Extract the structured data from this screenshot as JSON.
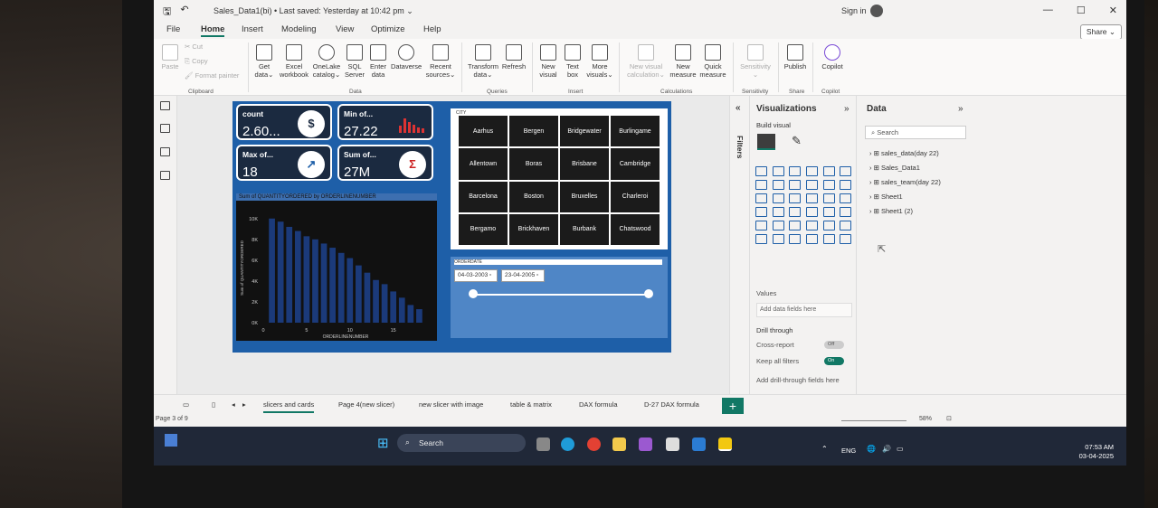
{
  "window": {
    "title": "Sales_Data1(bi) • Last saved: Yesterday at 10:42 pm ⌄",
    "signin": "Sign in"
  },
  "menu": {
    "tabs": [
      "File",
      "Home",
      "Insert",
      "Modeling",
      "View",
      "Optimize",
      "Help"
    ],
    "active": "Home",
    "share": "Share ⌄"
  },
  "ribbon": {
    "clipboard": {
      "paste": "Paste",
      "cut": "Cut",
      "copy": "Copy",
      "format_painter": "Format painter",
      "group": "Clipboard"
    },
    "data": {
      "get_data": "Get data⌄",
      "excel": "Excel workbook",
      "onelake": "OneLake catalog⌄",
      "sql": "SQL Server",
      "enter": "Enter data",
      "dataverse": "Dataverse",
      "recent": "Recent sources⌄",
      "group": "Data"
    },
    "queries": {
      "transform": "Transform data⌄",
      "refresh": "Refresh",
      "group": "Queries"
    },
    "insert": {
      "new_visual": "New visual",
      "text_box": "Text box",
      "more_visuals": "More visuals⌄",
      "group": "Insert"
    },
    "calculations": {
      "new_visual_calc": "New visual calculation⌄",
      "new_measure": "New measure",
      "quick_measure": "Quick measure",
      "group": "Calculations"
    },
    "sensitivity": {
      "label": "Sensitivity ⌄",
      "group": "Sensitivity"
    },
    "share": {
      "publish": "Publish",
      "group": "Share"
    },
    "copilot": {
      "label": "Copilot",
      "group": "Copilot"
    }
  },
  "report": {
    "cards": [
      {
        "title": "count",
        "value": "2.60..."
      },
      {
        "title": "Min of...",
        "value": "27.22"
      },
      {
        "title": "Max of...",
        "value": "18"
      },
      {
        "title": "Sum of...",
        "value": "27M"
      }
    ],
    "chart_title": "Sum of QUANTITYORDERED by ORDERLINENUMBER",
    "slicer_title": "CITY",
    "cities": [
      "Aarhus",
      "Bergen",
      "Bridgewater",
      "Burlingame",
      "Allentown",
      "Boras",
      "Brisbane",
      "Cambridge",
      "Barcelona",
      "Boston",
      "Bruxelles",
      "Charleroi",
      "Bergamo",
      "Brickhaven",
      "Burbank",
      "Chatswood"
    ],
    "date_slicer": {
      "title": "ORDERDATE",
      "start": "04-03-2003",
      "end": "23-04-2005"
    }
  },
  "chart_data": {
    "type": "bar",
    "title": "Sum of QUANTITYORDERED by ORDERLINENUMBER",
    "xlabel": "ORDERLINENUMBER",
    "ylabel": "Sum of QUANTITYORDERED",
    "x": [
      1,
      2,
      3,
      4,
      5,
      6,
      7,
      8,
      9,
      10,
      11,
      12,
      13,
      14,
      15,
      16,
      17,
      18
    ],
    "values": [
      10000,
      9700,
      9200,
      8800,
      8300,
      8000,
      7600,
      7200,
      6700,
      6200,
      5500,
      4800,
      4100,
      3700,
      3000,
      2400,
      1700,
      1300
    ],
    "ylim": [
      0,
      10500
    ],
    "xticks": [
      "0",
      "5",
      "10",
      "15"
    ],
    "yticks": [
      "0K",
      "2K",
      "4K",
      "6K",
      "8K",
      "10K"
    ]
  },
  "filters": {
    "label": "Filters"
  },
  "viz_pane": {
    "title": "Visualizations",
    "build": "Build visual",
    "values": "Values",
    "add_fields": "Add data fields here",
    "drill": "Drill through",
    "cross": "Cross-report",
    "cross_state": "Off",
    "keep": "Keep all filters",
    "keep_state": "On",
    "add_drill": "Add drill-through fields here"
  },
  "data_pane": {
    "title": "Data",
    "search": "Search",
    "tables": [
      "sales_data(day 22)",
      "Sales_Data1",
      "sales_team(day 22)",
      "Sheet1",
      "Sheet1 (2)"
    ]
  },
  "pages": {
    "tabs": [
      "slicers and cards",
      "Page 4(new slicer)",
      "new slicer with image",
      "table & matrix",
      "DAX formula",
      "D-27 DAX formula"
    ],
    "active": "slicers and cards",
    "status": "Page 3 of 9",
    "zoom": "58%"
  },
  "taskbar": {
    "search": "Search",
    "lang": "ENG",
    "time": "07:53 AM",
    "date": "03-04-2025"
  },
  "colors": {
    "accent": "#117865",
    "report_bg": "#1e5fa8",
    "taskbar": "#202838"
  }
}
